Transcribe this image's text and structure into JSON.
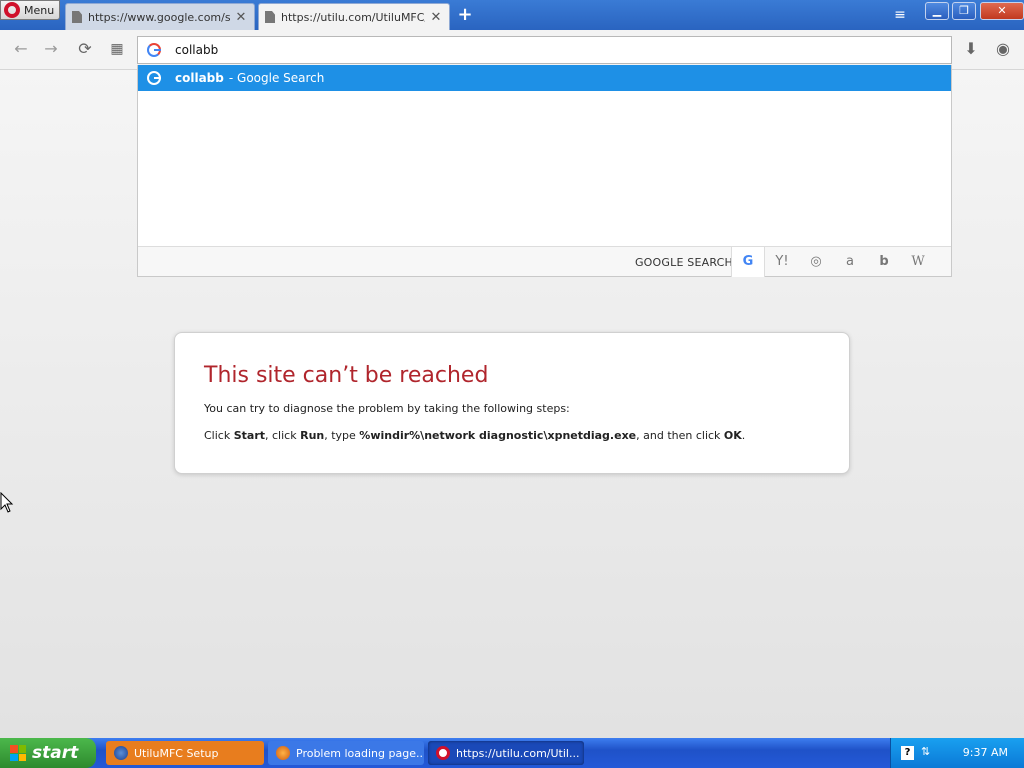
{
  "browser": {
    "menu_label": "Menu",
    "tabs": [
      {
        "title": "https://www.google.com/se",
        "close": "✕"
      },
      {
        "title": "https://utilu.com/UtiluMFC/ i",
        "close": "✕"
      }
    ],
    "new_tab_symbol": "+",
    "window_buttons": {
      "minimize": "▁",
      "maximize": "❐",
      "close": "✕"
    }
  },
  "toolbar": {
    "back": "←",
    "forward": "→",
    "reload": "⟳",
    "speed_dial": "▦",
    "download": "⬇",
    "account": "◉",
    "address_value": "collabb"
  },
  "dropdown": {
    "suggestion_query": "collabb",
    "suggestion_suffix": "- Google Search",
    "engines_label": "GOOGLE SEARCH",
    "engines": {
      "google": "G",
      "yahoo": "Y!",
      "duckduckgo": "◎",
      "amazon": "a",
      "bing": "b",
      "wikipedia": "W"
    }
  },
  "error": {
    "title": "This site can’t be reached",
    "intro": "You can try to diagnose the problem by taking the following steps:",
    "step_parts": {
      "p1": "Click ",
      "start": "Start",
      "p2": ", click ",
      "run": "Run",
      "p3": ", type ",
      "cmd": "%windir%\\network diagnostic\\xpnetdiag.exe",
      "p4": ", and then click ",
      "ok": "OK",
      "p5": "."
    }
  },
  "taskbar": {
    "start_label": "start",
    "tasks": [
      {
        "label": "UtiluMFC Setup"
      },
      {
        "label": "Problem loading page..."
      },
      {
        "label": "https://utilu.com/Util..."
      }
    ],
    "help": "?",
    "clock": "9:37 AM"
  },
  "colors": {
    "accent": "#1e90e6",
    "error_title": "#b0252c",
    "taskbar": "#245edb",
    "start": "#3c9a3c"
  }
}
